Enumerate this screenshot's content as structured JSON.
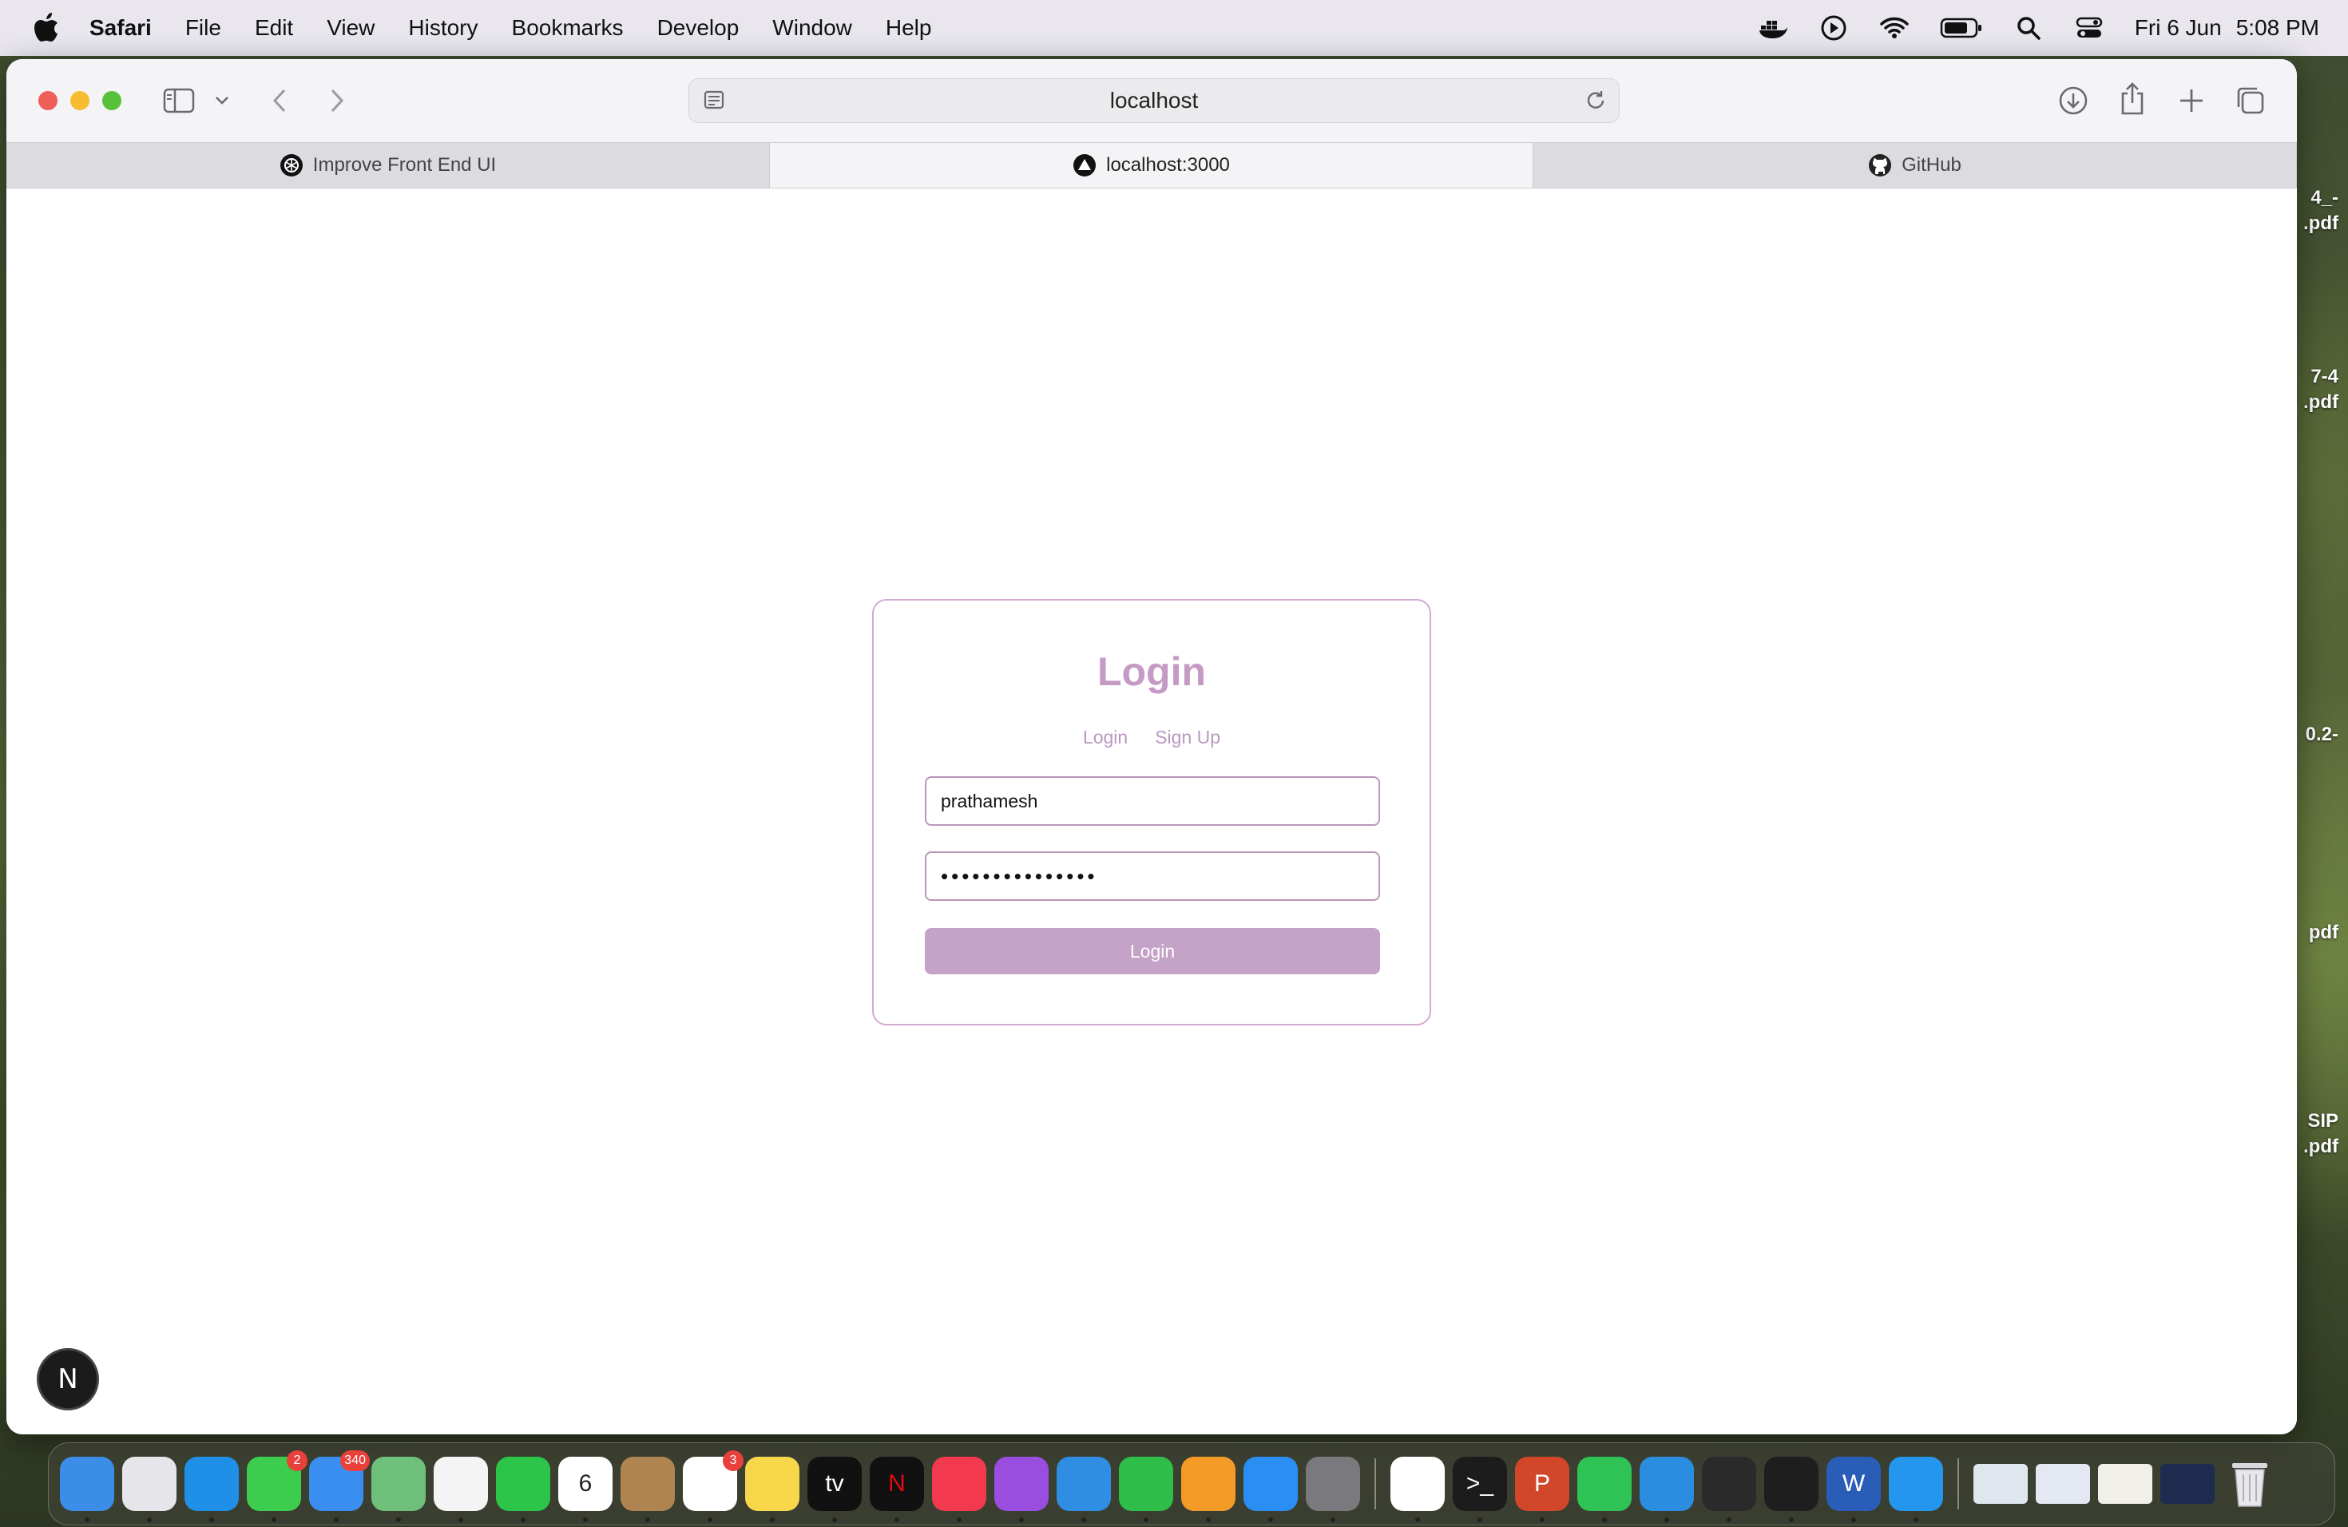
{
  "menubar": {
    "app": "Safari",
    "items": [
      "File",
      "Edit",
      "View",
      "History",
      "Bookmarks",
      "Develop",
      "Window",
      "Help"
    ],
    "date": "Fri 6 Jun",
    "time": "5:08 PM"
  },
  "browser": {
    "url": "localhost",
    "tabs": [
      {
        "label": "Improve Front End UI",
        "icon": "chatgpt-icon"
      },
      {
        "label": "localhost:3000",
        "icon": "vercel-triangle-icon"
      },
      {
        "label": "GitHub",
        "icon": "github-icon"
      }
    ]
  },
  "login": {
    "title": "Login",
    "tab_login": "Login",
    "tab_signup": "Sign Up",
    "username_value": "prathamesh",
    "password_value": "•••••••••••••••",
    "submit_label": "Login"
  },
  "next_badge": "N",
  "desktop_files": [
    "4_-\n.pdf",
    "7-4\n.pdf",
    "0.2-",
    "pdf",
    "SIP\n.pdf"
  ],
  "dock": {
    "apps": [
      {
        "name": "Finder",
        "color": "#3b8de8"
      },
      {
        "name": "Launchpad",
        "color": "#e6e6ea"
      },
      {
        "name": "Safari",
        "color": "#1f8fe8"
      },
      {
        "name": "Messages",
        "color": "#3ccd4e",
        "badge": "2"
      },
      {
        "name": "Mail",
        "color": "#3a8ef0",
        "badge": "340"
      },
      {
        "name": "Maps",
        "color": "#6fc07a"
      },
      {
        "name": "Photos",
        "color": "#f4f4f4"
      },
      {
        "name": "FaceTime",
        "color": "#2dc44a"
      },
      {
        "name": "Calendar",
        "color": "#ffffff",
        "label": "6"
      },
      {
        "name": "Contacts",
        "color": "#b08450"
      },
      {
        "name": "Reminders",
        "color": "#ffffff",
        "badge": "3"
      },
      {
        "name": "Notes",
        "color": "#f8d74a"
      },
      {
        "name": "TV",
        "color": "#111111",
        "label": "tv"
      },
      {
        "name": "Netflix",
        "color": "#111111",
        "label": "N"
      },
      {
        "name": "Music",
        "color": "#f2394e"
      },
      {
        "name": "Podcasts",
        "color": "#9a4ee0"
      },
      {
        "name": "Keynote",
        "color": "#2f8de4"
      },
      {
        "name": "Numbers",
        "color": "#2fbe4a"
      },
      {
        "name": "Pages",
        "color": "#f49b27"
      },
      {
        "name": "App Store",
        "color": "#2b8ef2"
      },
      {
        "name": "System Settings",
        "color": "#7a7a7e"
      },
      {
        "name": "Chrome",
        "color": "#ffffff"
      },
      {
        "name": "Terminal",
        "color": "#1c1c1c",
        "label": ">_"
      },
      {
        "name": "PowerPoint",
        "color": "#d2462a",
        "label": "P"
      },
      {
        "name": "WhatsApp",
        "color": "#2fc356"
      },
      {
        "name": "VS Code",
        "color": "#2a8de0"
      },
      {
        "name": "Activity Monitor",
        "color": "#2a2a2a"
      },
      {
        "name": "Cursor",
        "color": "#1e1e1e"
      },
      {
        "name": "Word",
        "color": "#2a5db8",
        "label": "W"
      },
      {
        "name": "Docker",
        "color": "#2496ed"
      }
    ]
  }
}
